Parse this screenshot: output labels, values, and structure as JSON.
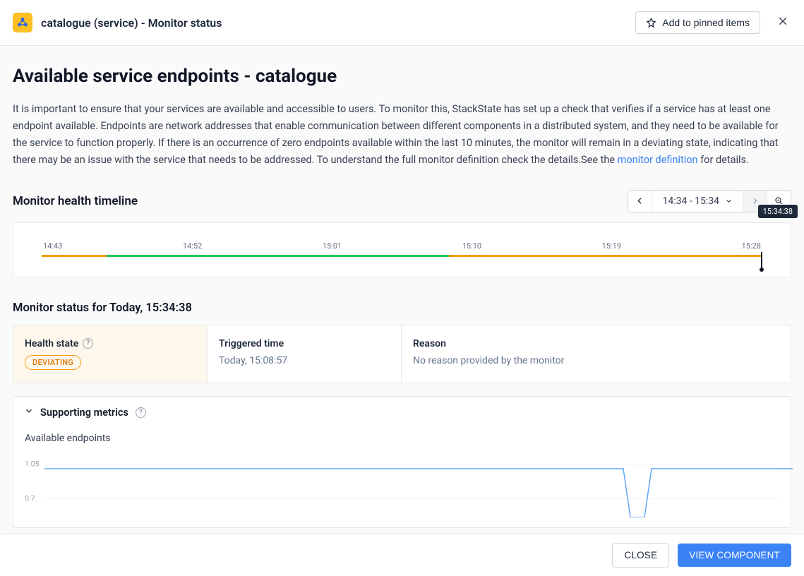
{
  "header": {
    "title": "catalogue (service) - Monitor status",
    "pin_button": "Add to pinned items"
  },
  "page": {
    "title": "Available service endpoints - catalogue",
    "description_pre": "It is important to ensure that your services are available and accessible to users. To monitor this, StackState has set up a check that verifies if a service has at least one endpoint available. Endpoints are network addresses that enable communication between different components in a distributed system, and they need to be available for the service to function properly. If there is an occurrence of zero endpoints available within the last 10 minutes, the monitor will remain in a deviating state, indicating that there may be an issue with the service that needs to be addressed. To understand the full monitor definition check the details.See the ",
    "description_link": "monitor definition",
    "description_post": " for details."
  },
  "timeline": {
    "section_title": "Monitor health timeline",
    "range_label": "14:34 - 15:34",
    "cursor_label": "15:34:38",
    "ticks": [
      "14:43",
      "14:52",
      "15:01",
      "15:10",
      "15:19",
      "15:28"
    ]
  },
  "status": {
    "section_title": "Monitor status for Today, 15:34:38",
    "health_label": "Health state",
    "health_badge": "DEVIATING",
    "triggered_label": "Triggered time",
    "triggered_value": "Today, 15:08:57",
    "reason_label": "Reason",
    "reason_value": "No reason provided by the monitor"
  },
  "metrics": {
    "title": "Supporting metrics",
    "chart_title": "Available endpoints"
  },
  "chart_data": {
    "type": "line",
    "title": "Available endpoints",
    "xlabel": "",
    "ylabel": "",
    "ylim": [
      0.5,
      1.05
    ],
    "y_ticks": [
      1.05,
      0.7
    ],
    "x_range": [
      "14:34",
      "15:34"
    ],
    "series": [
      {
        "name": "endpoints",
        "x": [
          "14:35",
          "15:19",
          "15:20",
          "15:21",
          "15:34"
        ],
        "values": [
          1.0,
          1.0,
          0.5,
          1.0,
          1.0
        ]
      }
    ]
  },
  "footer": {
    "close": "CLOSE",
    "view": "VIEW COMPONENT"
  }
}
